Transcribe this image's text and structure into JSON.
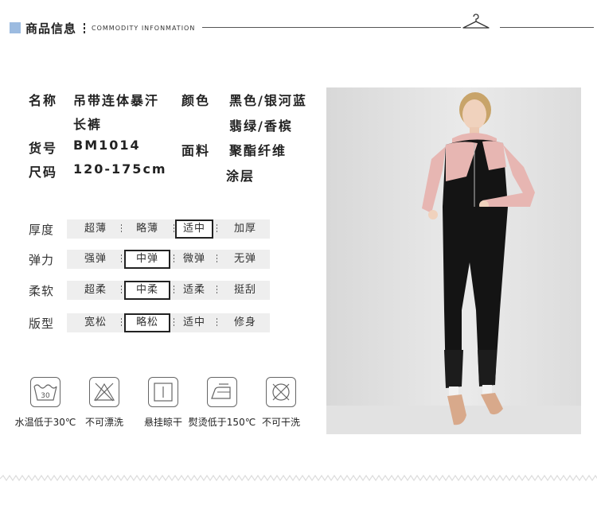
{
  "header": {
    "title": "商品信息",
    "subtitle": "COMMODITY INFONMATION"
  },
  "info": {
    "name_label": "名称",
    "name_value_line1": "吊带连体暴汗",
    "name_value_line2": "长裤",
    "color_label": "颜色",
    "color_value_line1": "黑色/银河蓝",
    "color_value_line2": "翡绿/香槟",
    "sku_label": "货号",
    "sku_value": "BM1014",
    "fabric_label": "面料",
    "fabric_value_line1": "聚酯纤维",
    "fabric_value_line2": "涂层",
    "size_label": "尺码",
    "size_value": "120-175cm"
  },
  "attributes": [
    {
      "label": "厚度",
      "options": [
        "超薄",
        "略薄",
        "适中",
        "加厚"
      ],
      "selected": "适中"
    },
    {
      "label": "弹力",
      "options": [
        "强弹",
        "中弹",
        "微弹",
        "无弹"
      ],
      "selected": "中弹"
    },
    {
      "label": "柔软",
      "options": [
        "超柔",
        "中柔",
        "适柔",
        "挺刮"
      ],
      "selected": "中柔"
    },
    {
      "label": "版型",
      "options": [
        "宽松",
        "略松",
        "适中",
        "修身"
      ],
      "selected": "略松"
    }
  ],
  "care": [
    {
      "icon": "wash-30-icon",
      "label": "水温低于30℃",
      "mark": "30"
    },
    {
      "icon": "no-bleach-icon",
      "label": "不可漂洗"
    },
    {
      "icon": "hang-dry-icon",
      "label": "悬挂晾干"
    },
    {
      "icon": "iron-150-icon",
      "label": "熨烫低于150℃"
    },
    {
      "icon": "no-dry-clean-icon",
      "label": "不可干洗"
    }
  ],
  "colors": {
    "accent": "#9cbbe0",
    "jacket_pink": "#e7b6b2",
    "garment_black": "#141414"
  }
}
